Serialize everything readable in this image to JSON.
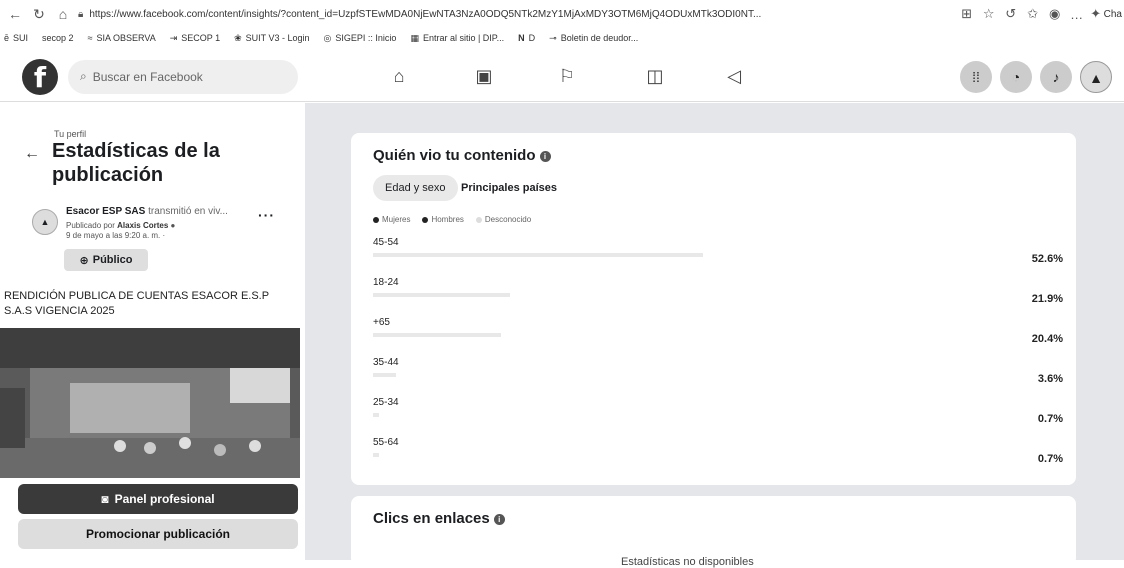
{
  "browser": {
    "url": "https://www.facebook.com/content/insights/?content_id=UzpfSTEwMDA0NjEwNTA3NzA0ODQ5NTk2MzY1MjAxMDY3OTM6MjQ4ODUxMTk3ODI0NT...",
    "bookmarks": [
      "SUI",
      "secop 2",
      "SIA OBSERVA",
      "SECOP 1",
      "SUIT V3 - Login",
      "SIGEPI :: Inicio",
      "Entrar al sitio | DIP...",
      "D",
      "Boletin de deudor..."
    ],
    "chat_label": "Cha"
  },
  "fb": {
    "search_placeholder": "Buscar en Facebook"
  },
  "left": {
    "profile_small": "Tu perfil",
    "title": "Estadísticas de la publicación",
    "post_author": "Esacor ESP SAS",
    "post_action": "transmitió en viv...",
    "published_by_prefix": "Publicado por",
    "published_by_name": "Alaxis Cortes",
    "post_time": "9 de mayo a las 9:20 a. m. ·",
    "public_label": "Público",
    "post_text": "RENDICIÓN PUBLICA DE CUENTAS ESACOR E.S.P S.A.S VIGENCIA 2025",
    "panel_button": "Panel profesional",
    "promote_button": "Promocionar publicación"
  },
  "card1": {
    "title": "Quién vio tu contenido",
    "tab_age": "Edad y sexo",
    "tab_countries": "Principales países",
    "legend": [
      "Mujeres",
      "Hombres",
      "Desconocido"
    ],
    "rows": [
      {
        "label": "45-54",
        "percent": "52.6%",
        "value": 52.6
      },
      {
        "label": "18-24",
        "percent": "21.9%",
        "value": 21.9
      },
      {
        "label": "+65",
        "percent": "20.4%",
        "value": 20.4
      },
      {
        "label": "35-44",
        "percent": "3.6%",
        "value": 3.6
      },
      {
        "label": "25-34",
        "percent": "0.7%",
        "value": 0.7
      },
      {
        "label": "55-64",
        "percent": "0.7%",
        "value": 0.7
      }
    ]
  },
  "card2": {
    "title": "Clics en enlaces",
    "bottom_text": "Estadísticas no disponibles"
  }
}
